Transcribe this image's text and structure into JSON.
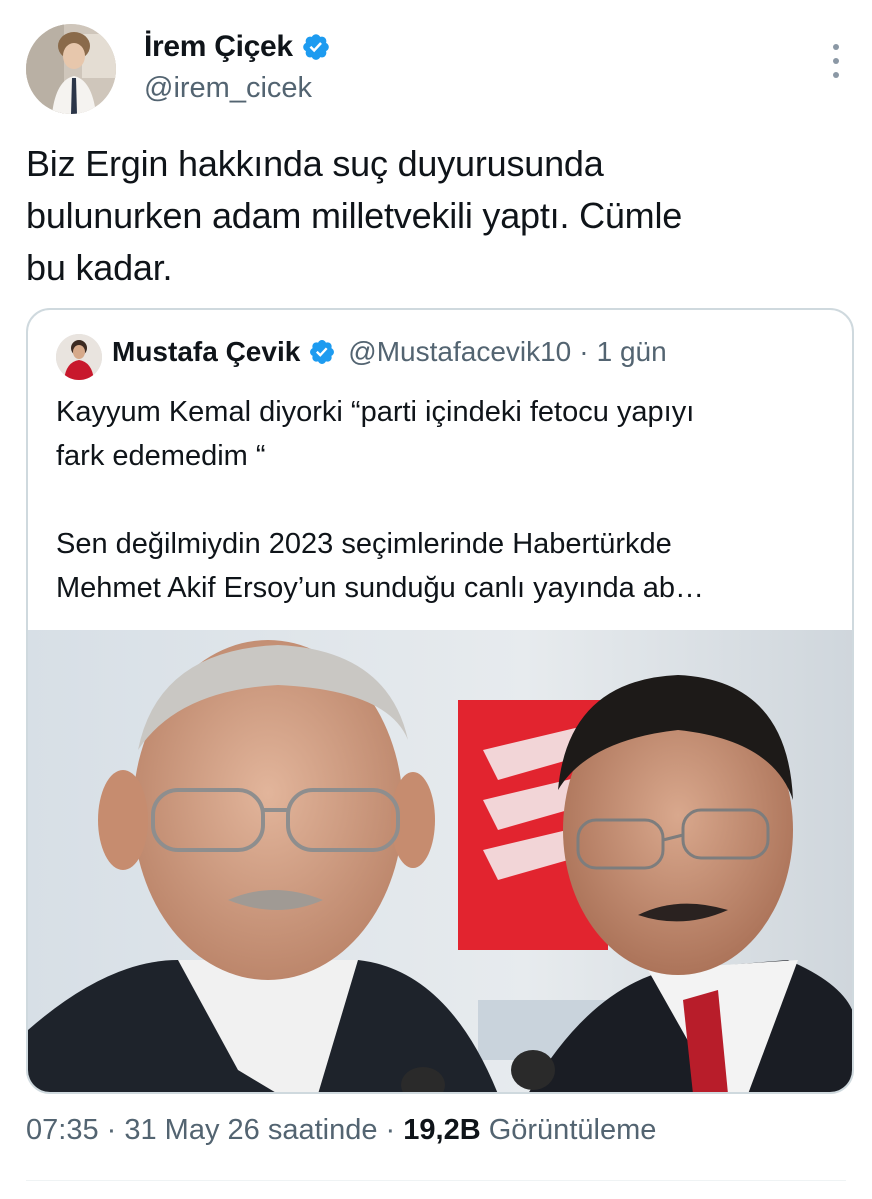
{
  "author": {
    "display_name": "İrem Çiçek",
    "handle": "@irem_cicek",
    "verified_icon": "verified-badge-icon",
    "avatar_icon": "avatar"
  },
  "tweet": {
    "text": "Biz Ergin hakkında suç duyurusunda\nbulunurken adam milletvekili yaptı. Cümle\nbu kadar."
  },
  "quote": {
    "display_name": "Mustafa Çevik",
    "handle": "@Mustafacevik10",
    "separator": "·",
    "time": "1 gün",
    "text": "Kayyum Kemal diyorki “parti içindeki fetocu yapıyı\nfark edemedim “\n\nSen değilmiydin 2023 seçimlerinde Habertürkde\nMehmet Akif Ersoy’un sunduğu canlı yayında ab…",
    "image_icon": "photo-two-men"
  },
  "footer": {
    "time": "07:35",
    "sep1": " · ",
    "date": "31 May 26 saatinde",
    "sep2": " · ",
    "views_count": "19,2B",
    "views_label": " Görüntüleme"
  },
  "colors": {
    "verified": "#1d9bf0",
    "secondary_text": "#536471",
    "primary_text": "#0f1419",
    "border": "#cfd9de"
  }
}
